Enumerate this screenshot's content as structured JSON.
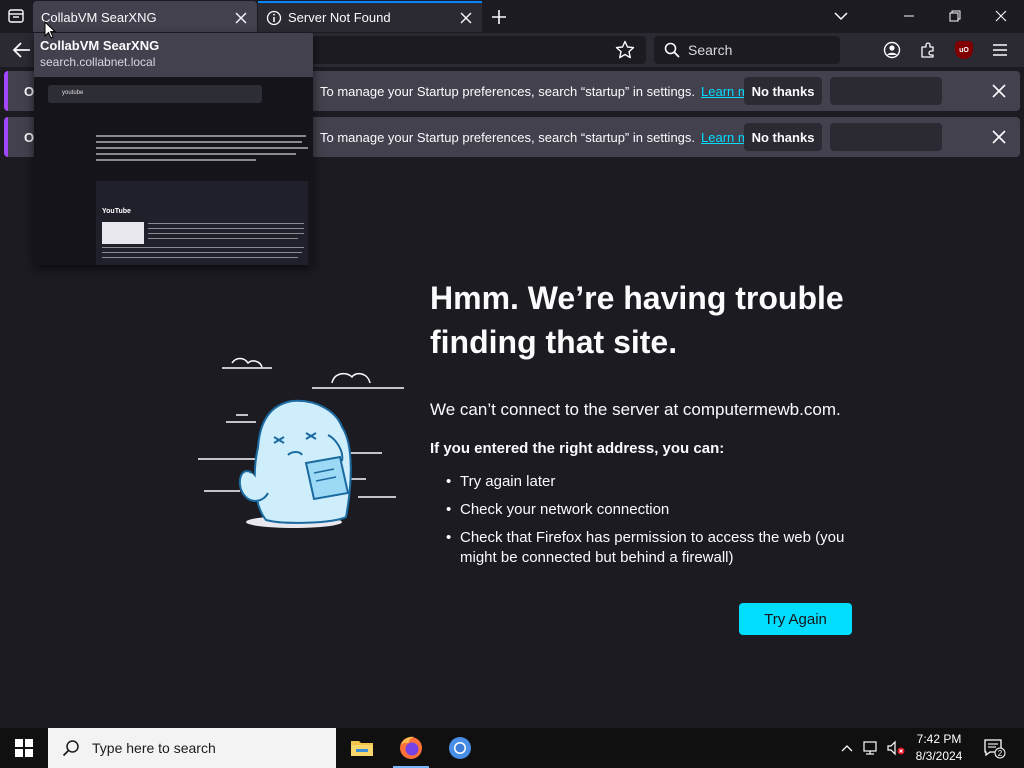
{
  "browser": {
    "tabs": [
      {
        "title": "CollabVM SearXNG"
      },
      {
        "title": "Server Not Found"
      }
    ],
    "search": {
      "placeholder": "Search"
    },
    "tab_preview": {
      "title": "CollabVM SearXNG",
      "url": "search.collabnet.local",
      "thumbnail": {
        "query": "youtube",
        "result_title": "YouTube"
      }
    },
    "notifications": [
      {
        "lead": "Op",
        "message": "To manage your Startup preferences, search “startup” in settings.",
        "link": "Learn more",
        "button": "No thanks"
      },
      {
        "lead": "Op",
        "message": "To manage your Startup preferences, search “startup” in settings.",
        "link": "Learn more",
        "button": "No thanks"
      }
    ]
  },
  "error_page": {
    "heading": "Hmm. We’re having trouble finding that site.",
    "connect_message": "We can’t connect to the server at computermewb.com.",
    "advice_heading": "If you entered the right address, you can:",
    "tips": [
      "Try again later",
      "Check your network connection",
      "Check that Firefox has permission to access the web (you might be connected but behind a firewall)"
    ],
    "try_again_label": "Try Again"
  },
  "taskbar": {
    "search_placeholder": "Type here to search",
    "time": "7:42 PM",
    "date": "8/3/2024",
    "notification_count": "2"
  },
  "colors": {
    "accent": "#00ddff",
    "notification_bar": "#a347ff",
    "page_bg": "#1c1b22"
  }
}
